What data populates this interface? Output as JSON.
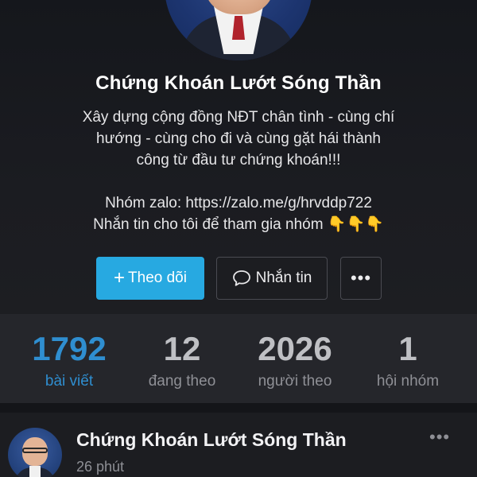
{
  "profile": {
    "name": "Chứng Khoán Lướt Sóng Thần",
    "bio_lines": [
      "Xây dựng cộng đồng NĐT chân tình - cùng chí",
      "hướng - cùng cho đi và cùng gặt hái thành",
      "công từ đầu tư chứng khoán!!!"
    ],
    "zalo_line": "Nhóm zalo: https://zalo.me/g/hrvddp722",
    "invite_line": "Nhắn tin cho tôi để tham gia nhóm",
    "invite_emoji": "👇👇👇"
  },
  "actions": {
    "follow_icon": "+",
    "follow_label": "Theo dõi",
    "message_label": "Nhắn tin",
    "more_label": "•••"
  },
  "stats": [
    {
      "value": "1792",
      "label": "bài viết",
      "active": true
    },
    {
      "value": "12",
      "label": "đang theo",
      "active": false
    },
    {
      "value": "2026",
      "label": "người theo",
      "active": false
    },
    {
      "value": "1",
      "label": "hội nhóm",
      "active": false
    }
  ],
  "post": {
    "author": "Chứng Khoán Lướt Sóng Thần",
    "time": "26 phút",
    "more_label": "•••"
  },
  "colors": {
    "accent": "#27a9e1",
    "active_stat": "#2f8ed0",
    "background": "#1a1b1f"
  }
}
